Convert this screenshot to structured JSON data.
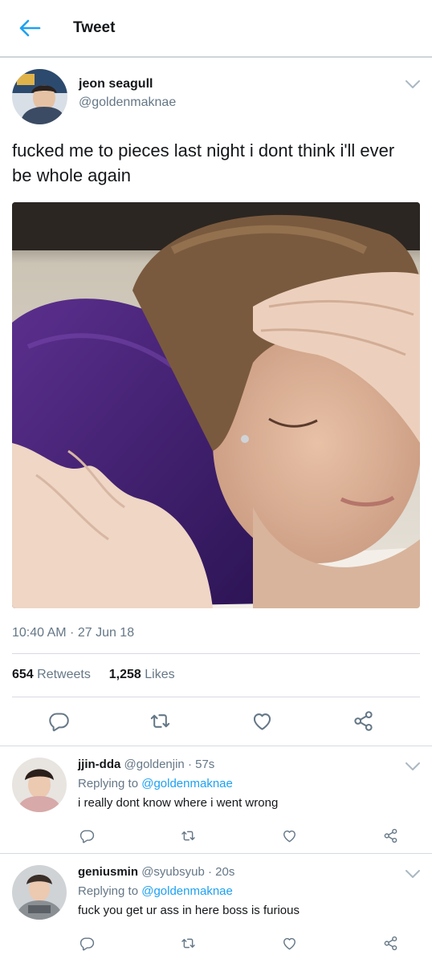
{
  "header": {
    "title": "Tweet",
    "back_icon": "arrow-left-icon",
    "accent": "#1da1f2"
  },
  "tweet": {
    "author_name": "jeon seagull",
    "author_handle": "@goldenmaknae",
    "text": "fucked me to pieces last night i dont think i'll ever be whole again",
    "timestamp": "10:40 AM · 27 Jun 18",
    "retweets_count": "654",
    "retweets_label": "Retweets",
    "likes_count": "1,258",
    "likes_label": "Likes",
    "actions": [
      "reply-icon",
      "retweet-icon",
      "like-icon",
      "share-icon"
    ]
  },
  "replies": [
    {
      "name": "jjin-dda",
      "handle": "@goldenjin",
      "time": "57s",
      "replying_prefix": "Replying to",
      "replying_to": "@goldenmaknae",
      "text": "i really dont know where i went wrong"
    },
    {
      "name": "geniusmin",
      "handle": "@syubsyub",
      "time": "20s",
      "replying_prefix": "Replying to",
      "replying_to": "@goldenmaknae",
      "text": "fuck you get ur ass in here boss is furious"
    }
  ],
  "colors": {
    "secondary_text": "#657786",
    "primary_text": "#14171a",
    "divider": "#d6dbe0",
    "link": "#1da1f2"
  }
}
